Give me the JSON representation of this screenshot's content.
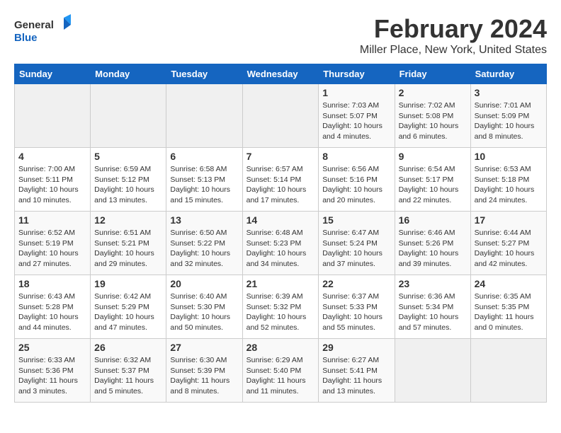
{
  "header": {
    "logo_line1": "General",
    "logo_line2": "Blue",
    "month": "February 2024",
    "location": "Miller Place, New York, United States"
  },
  "weekdays": [
    "Sunday",
    "Monday",
    "Tuesday",
    "Wednesday",
    "Thursday",
    "Friday",
    "Saturday"
  ],
  "weeks": [
    [
      {
        "day": "",
        "info": ""
      },
      {
        "day": "",
        "info": ""
      },
      {
        "day": "",
        "info": ""
      },
      {
        "day": "",
        "info": ""
      },
      {
        "day": "1",
        "info": "Sunrise: 7:03 AM\nSunset: 5:07 PM\nDaylight: 10 hours\nand 4 minutes."
      },
      {
        "day": "2",
        "info": "Sunrise: 7:02 AM\nSunset: 5:08 PM\nDaylight: 10 hours\nand 6 minutes."
      },
      {
        "day": "3",
        "info": "Sunrise: 7:01 AM\nSunset: 5:09 PM\nDaylight: 10 hours\nand 8 minutes."
      }
    ],
    [
      {
        "day": "4",
        "info": "Sunrise: 7:00 AM\nSunset: 5:11 PM\nDaylight: 10 hours\nand 10 minutes."
      },
      {
        "day": "5",
        "info": "Sunrise: 6:59 AM\nSunset: 5:12 PM\nDaylight: 10 hours\nand 13 minutes."
      },
      {
        "day": "6",
        "info": "Sunrise: 6:58 AM\nSunset: 5:13 PM\nDaylight: 10 hours\nand 15 minutes."
      },
      {
        "day": "7",
        "info": "Sunrise: 6:57 AM\nSunset: 5:14 PM\nDaylight: 10 hours\nand 17 minutes."
      },
      {
        "day": "8",
        "info": "Sunrise: 6:56 AM\nSunset: 5:16 PM\nDaylight: 10 hours\nand 20 minutes."
      },
      {
        "day": "9",
        "info": "Sunrise: 6:54 AM\nSunset: 5:17 PM\nDaylight: 10 hours\nand 22 minutes."
      },
      {
        "day": "10",
        "info": "Sunrise: 6:53 AM\nSunset: 5:18 PM\nDaylight: 10 hours\nand 24 minutes."
      }
    ],
    [
      {
        "day": "11",
        "info": "Sunrise: 6:52 AM\nSunset: 5:19 PM\nDaylight: 10 hours\nand 27 minutes."
      },
      {
        "day": "12",
        "info": "Sunrise: 6:51 AM\nSunset: 5:21 PM\nDaylight: 10 hours\nand 29 minutes."
      },
      {
        "day": "13",
        "info": "Sunrise: 6:50 AM\nSunset: 5:22 PM\nDaylight: 10 hours\nand 32 minutes."
      },
      {
        "day": "14",
        "info": "Sunrise: 6:48 AM\nSunset: 5:23 PM\nDaylight: 10 hours\nand 34 minutes."
      },
      {
        "day": "15",
        "info": "Sunrise: 6:47 AM\nSunset: 5:24 PM\nDaylight: 10 hours\nand 37 minutes."
      },
      {
        "day": "16",
        "info": "Sunrise: 6:46 AM\nSunset: 5:26 PM\nDaylight: 10 hours\nand 39 minutes."
      },
      {
        "day": "17",
        "info": "Sunrise: 6:44 AM\nSunset: 5:27 PM\nDaylight: 10 hours\nand 42 minutes."
      }
    ],
    [
      {
        "day": "18",
        "info": "Sunrise: 6:43 AM\nSunset: 5:28 PM\nDaylight: 10 hours\nand 44 minutes."
      },
      {
        "day": "19",
        "info": "Sunrise: 6:42 AM\nSunset: 5:29 PM\nDaylight: 10 hours\nand 47 minutes."
      },
      {
        "day": "20",
        "info": "Sunrise: 6:40 AM\nSunset: 5:30 PM\nDaylight: 10 hours\nand 50 minutes."
      },
      {
        "day": "21",
        "info": "Sunrise: 6:39 AM\nSunset: 5:32 PM\nDaylight: 10 hours\nand 52 minutes."
      },
      {
        "day": "22",
        "info": "Sunrise: 6:37 AM\nSunset: 5:33 PM\nDaylight: 10 hours\nand 55 minutes."
      },
      {
        "day": "23",
        "info": "Sunrise: 6:36 AM\nSunset: 5:34 PM\nDaylight: 10 hours\nand 57 minutes."
      },
      {
        "day": "24",
        "info": "Sunrise: 6:35 AM\nSunset: 5:35 PM\nDaylight: 11 hours\nand 0 minutes."
      }
    ],
    [
      {
        "day": "25",
        "info": "Sunrise: 6:33 AM\nSunset: 5:36 PM\nDaylight: 11 hours\nand 3 minutes."
      },
      {
        "day": "26",
        "info": "Sunrise: 6:32 AM\nSunset: 5:37 PM\nDaylight: 11 hours\nand 5 minutes."
      },
      {
        "day": "27",
        "info": "Sunrise: 6:30 AM\nSunset: 5:39 PM\nDaylight: 11 hours\nand 8 minutes."
      },
      {
        "day": "28",
        "info": "Sunrise: 6:29 AM\nSunset: 5:40 PM\nDaylight: 11 hours\nand 11 minutes."
      },
      {
        "day": "29",
        "info": "Sunrise: 6:27 AM\nSunset: 5:41 PM\nDaylight: 11 hours\nand 13 minutes."
      },
      {
        "day": "",
        "info": ""
      },
      {
        "day": "",
        "info": ""
      }
    ]
  ]
}
